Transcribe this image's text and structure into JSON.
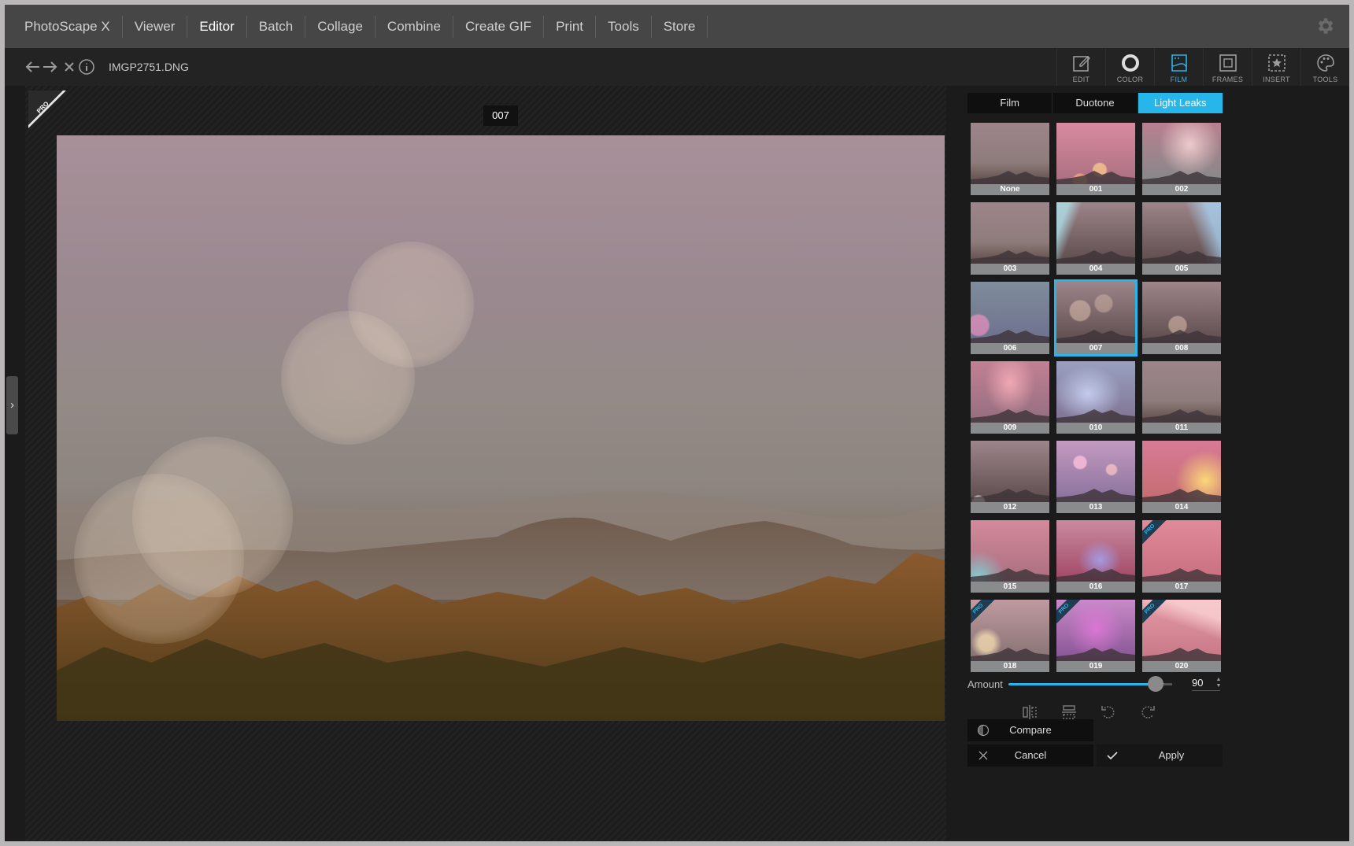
{
  "menu": {
    "items": [
      "PhotoScape X",
      "Viewer",
      "Editor",
      "Batch",
      "Collage",
      "Combine",
      "Create GIF",
      "Print",
      "Tools",
      "Store"
    ],
    "active": "Editor"
  },
  "file": {
    "name": "IMGP2751.DNG"
  },
  "toolbar": {
    "tools": [
      {
        "label": "EDIT",
        "icon": "edit-icon"
      },
      {
        "label": "COLOR",
        "icon": "color-icon"
      },
      {
        "label": "FILM",
        "icon": "film-icon"
      },
      {
        "label": "FRAMES",
        "icon": "frames-icon"
      },
      {
        "label": "INSERT",
        "icon": "insert-icon"
      },
      {
        "label": "TOOLS",
        "icon": "tools-icon"
      }
    ],
    "active": "FILM"
  },
  "canvas": {
    "preview_label": "007",
    "pro_ribbon": "PRO Version"
  },
  "panel": {
    "tabs": [
      "Film",
      "Duotone",
      "Light Leaks"
    ],
    "active_tab": "Light Leaks",
    "thumbnails": [
      {
        "label": "None",
        "pro": false
      },
      {
        "label": "001",
        "pro": false
      },
      {
        "label": "002",
        "pro": false
      },
      {
        "label": "003",
        "pro": false
      },
      {
        "label": "004",
        "pro": false
      },
      {
        "label": "005",
        "pro": false
      },
      {
        "label": "006",
        "pro": false
      },
      {
        "label": "007",
        "pro": false
      },
      {
        "label": "008",
        "pro": false
      },
      {
        "label": "009",
        "pro": false
      },
      {
        "label": "010",
        "pro": false
      },
      {
        "label": "011",
        "pro": false
      },
      {
        "label": "012",
        "pro": false
      },
      {
        "label": "013",
        "pro": false
      },
      {
        "label": "014",
        "pro": false
      },
      {
        "label": "015",
        "pro": false
      },
      {
        "label": "016",
        "pro": false
      },
      {
        "label": "017",
        "pro": true
      },
      {
        "label": "018",
        "pro": true
      },
      {
        "label": "019",
        "pro": true
      },
      {
        "label": "020",
        "pro": true
      }
    ],
    "selected": "007",
    "pro_badge": "PRO",
    "amount": {
      "label": "Amount",
      "value": "90",
      "fraction": 0.9
    },
    "buttons": {
      "compare": "Compare",
      "cancel": "Cancel",
      "apply": "Apply"
    }
  },
  "colors": {
    "accent": "#27b6ea",
    "menubar": "#464646",
    "background": "#1b1b1b"
  }
}
